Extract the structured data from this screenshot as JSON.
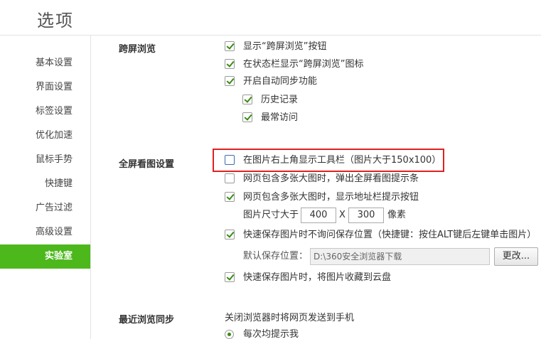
{
  "window": {
    "title": "选项"
  },
  "sidebar": {
    "items": [
      {
        "label": "基本设置"
      },
      {
        "label": "界面设置"
      },
      {
        "label": "标签设置"
      },
      {
        "label": "优化加速"
      },
      {
        "label": "鼠标手势"
      },
      {
        "label": "快捷键"
      },
      {
        "label": "广告过滤"
      },
      {
        "label": "高级设置"
      },
      {
        "label": "实验室",
        "active": true
      }
    ]
  },
  "sections": {
    "cross_screen": {
      "title": "跨屏浏览",
      "options": [
        {
          "label": "显示“跨屏浏览”按钮",
          "checked": true
        },
        {
          "label": "在状态栏显示“跨屏浏览”图标",
          "checked": true
        },
        {
          "label": "开启自动同步功能",
          "checked": true
        },
        {
          "label": "历史记录",
          "checked": true
        },
        {
          "label": "最常访问",
          "checked": true
        }
      ]
    },
    "fullscreen_image": {
      "title": "全屏看图设置",
      "options": [
        {
          "label": "在图片右上角显示工具栏（图片大于150x100）",
          "checked": false
        },
        {
          "label": "网页包含多张大图时，弹出全屏看图提示条",
          "checked": false
        },
        {
          "label": "网页包含多张大图时，显示地址栏提示按钮",
          "checked": true
        },
        {
          "label": "快速保存图片时不询问保存位置（快捷键：按住ALT键后左键单击图片）",
          "checked": true
        },
        {
          "label": "快速保存图片时，将图片收藏到云盘",
          "checked": true
        }
      ],
      "size_row": {
        "prefix": "图片尺寸大于",
        "width": "400",
        "separator": "X",
        "height": "300",
        "unit": "像素"
      },
      "save_location": {
        "label": "默认保存位置：",
        "path": "D:\\360安全浏览器下载",
        "change_button": "更改..."
      }
    },
    "recent_sync": {
      "title": "最近浏览同步",
      "description": "关闭浏览器时将网页发送到手机",
      "radio_option": {
        "label": "每次均提示我",
        "selected": true
      }
    }
  },
  "colors": {
    "accent_green": "#4cb81c",
    "highlight_red": "#e02020"
  }
}
